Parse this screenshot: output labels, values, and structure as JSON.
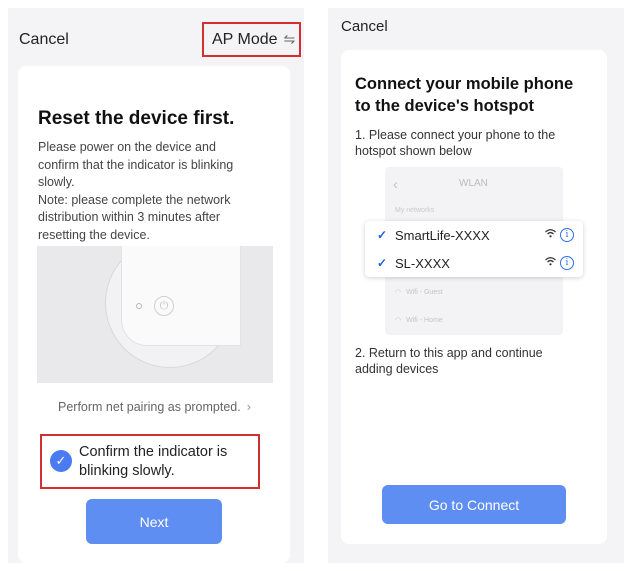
{
  "left_screen": {
    "cancel_label": "Cancel",
    "ap_mode_label": "AP Mode",
    "ap_mode_icon": "swap-arrows-icon",
    "title": "Reset the device first.",
    "description_lines": [
      "Please power on the device and",
      "confirm that the indicator is blinking",
      "slowly.",
      "Note: please complete the network",
      "distribution within 3 minutes after",
      "resetting the device."
    ],
    "pairing_link": "Perform net pairing as prompted.",
    "confirm_line1": "Confirm the indicator is",
    "confirm_line2": "blinking slowly.",
    "confirm_checked": true,
    "next_label": "Next"
  },
  "right_screen": {
    "cancel_label": "Cancel",
    "title_line1": "Connect your mobile phone",
    "title_line2": "to the device's hotspot",
    "step1_line1": "1. Please connect your phone to the",
    "step1_line2": "hotspot shown below",
    "mock": {
      "header": "WLAN",
      "section_label": "My networks",
      "other_networks": [
        "Wifi - Guest",
        "Wifi - Home"
      ]
    },
    "networks": [
      {
        "name": "SmartLife-XXXX"
      },
      {
        "name": "SL-XXXX"
      }
    ],
    "step2_line1": "2. Return to this app and continue",
    "step2_line2": "adding devices",
    "connect_label": "Go to Connect"
  },
  "colors": {
    "accent": "#5f8ef2",
    "highlight_border": "#d32f2f",
    "check_blue": "#1c5fe0"
  }
}
